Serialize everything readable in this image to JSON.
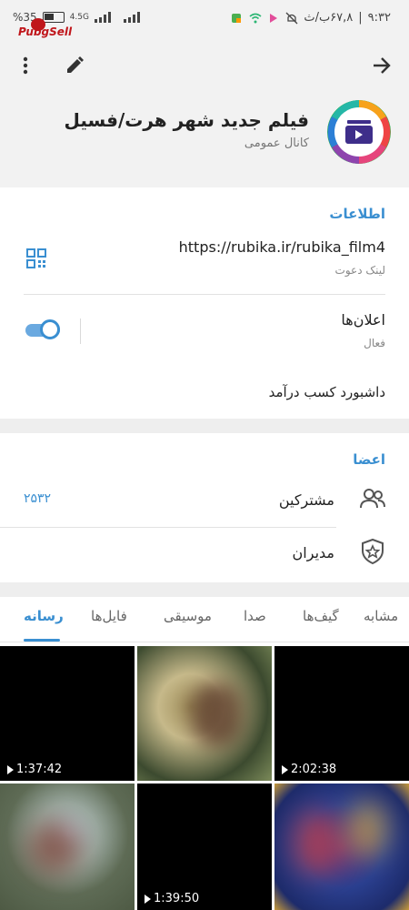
{
  "status": {
    "time": "۹:۳۲",
    "date": "۶۷,۸ب/ث",
    "battery": "35",
    "network": "4.5G",
    "watermark": "PubgSell"
  },
  "channel": {
    "title": "فیلم جدید شهر هرت/فسیل",
    "subtitle": "کانال عمومی"
  },
  "info": {
    "section_title": "اطلاعات",
    "link": "https://rubika.ir/rubika_film4",
    "link_label": "لینک دعوت",
    "notifications_label": "اعلان‌ها",
    "notifications_state": "فعال",
    "dashboard_label": "داشبورد کسب درآمد"
  },
  "members": {
    "section_title": "اعضا",
    "subscribers_label": "مشترکین",
    "subscribers_count": "۲۵۳۲",
    "admins_label": "مدیران"
  },
  "tabs": [
    "رسانه",
    "فایل‌ها",
    "موسیقی",
    "صدا",
    "گیف‌ها",
    "مشابه"
  ],
  "media": [
    {
      "duration": "1:37:42"
    },
    {
      "duration": ""
    },
    {
      "duration": "2:02:38"
    },
    {
      "duration": ""
    },
    {
      "duration": "1:39:50"
    },
    {
      "duration": ""
    }
  ],
  "colors": {
    "accent": "#3a8fd1",
    "header_bg": "#f2f2f2",
    "divider_bg": "#eeeeee"
  },
  "icons": {
    "back": "arrow-right-icon",
    "edit": "pencil-icon",
    "menu": "more-vert-icon",
    "qr": "qr-code-icon",
    "members": "people-icon",
    "admins": "shield-star-icon"
  }
}
